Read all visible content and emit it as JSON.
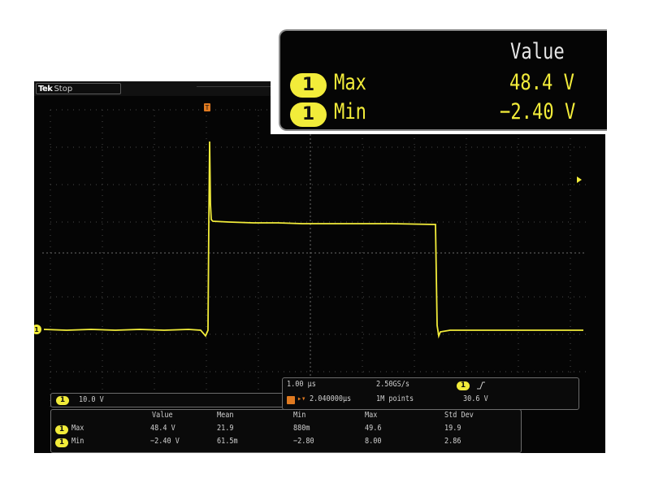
{
  "status": {
    "brand": "Tek",
    "state": "Stop"
  },
  "channel": {
    "number": "1",
    "color": "#f2ec3a",
    "scale_label": "10.0 V"
  },
  "trigger": {
    "marker": "T",
    "position_label": "2.040000µs",
    "level": "30.6 V",
    "slope_icon": "rising-edge-icon"
  },
  "timebase": {
    "scale": "1.00 µs",
    "sample_rate": "2.50GS/s",
    "record_length": "1M points"
  },
  "measurements": {
    "headers": [
      "Value",
      "Mean",
      "Min",
      "Max",
      "Std Dev"
    ],
    "rows": [
      {
        "channel": "1",
        "name": "Max",
        "value": "48.4 V",
        "mean": "21.9",
        "min": "880m",
        "max": "49.6",
        "std": "19.9"
      },
      {
        "channel": "1",
        "name": "Min",
        "value": "−2.40 V",
        "mean": "61.5m",
        "min": "−2.80",
        "max": "8.00",
        "std": "2.86"
      }
    ]
  },
  "zoom": {
    "header": "Value",
    "rows": [
      {
        "channel": "1",
        "name": "Max",
        "value": "48.4 V"
      },
      {
        "channel": "1",
        "name": "Min",
        "value": "−2.40 V"
      }
    ]
  }
}
